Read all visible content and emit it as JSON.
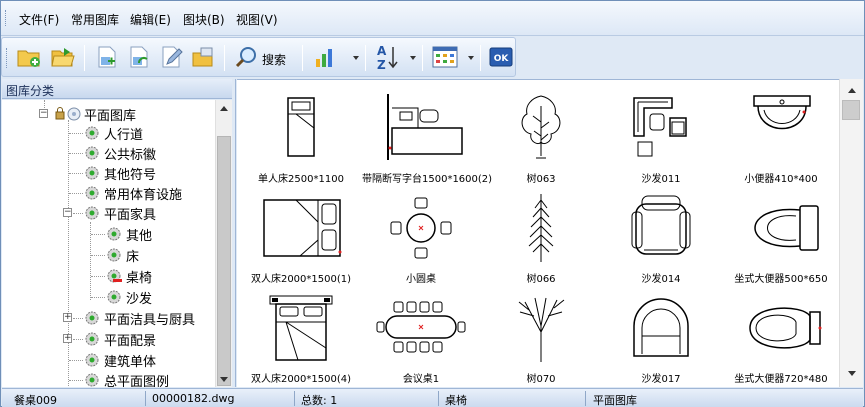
{
  "menu": {
    "items": [
      "文件(F)",
      "常用图库",
      "编辑(E)",
      "图块(B)",
      "视图(V)"
    ]
  },
  "toolbar": {
    "search_label": "搜索",
    "ok_label": "OK",
    "sort_label_top": "A",
    "sort_label_bottom": "Z"
  },
  "sidebar": {
    "header": "图库分类",
    "root": "平面图库",
    "items": [
      {
        "label": "人行道",
        "expander": ""
      },
      {
        "label": "公共标徽",
        "expander": ""
      },
      {
        "label": "其他符号",
        "expander": ""
      },
      {
        "label": "常用体育设施",
        "expander": ""
      },
      {
        "label": "平面家具",
        "expander": "−"
      },
      {
        "label": "其他",
        "expander": ""
      },
      {
        "label": "床",
        "expander": ""
      },
      {
        "label": "桌椅",
        "expander": ""
      },
      {
        "label": "沙发",
        "expander": ""
      },
      {
        "label": "平面洁具与厨具",
        "expander": "+"
      },
      {
        "label": "平面配景",
        "expander": "+"
      },
      {
        "label": "建筑单体",
        "expander": ""
      },
      {
        "label": "总平面图例",
        "expander": ""
      }
    ]
  },
  "grid": {
    "items": [
      {
        "caption": "单人床2500*1100",
        "icon": "single-bed-icon"
      },
      {
        "caption": "带隔断写字台1500*1600(2)",
        "icon": "partition-desk-icon"
      },
      {
        "caption": "树063",
        "icon": "tree-icon"
      },
      {
        "caption": "沙发011",
        "icon": "sofa-set-icon"
      },
      {
        "caption": "小便器410*400",
        "icon": "urinal-icon"
      },
      {
        "caption": "双人床2000*1500(1)",
        "icon": "double-bed-icon"
      },
      {
        "caption": "小圆桌",
        "icon": "round-table-icon"
      },
      {
        "caption": "树066",
        "icon": "conifer-tree-icon"
      },
      {
        "caption": "沙发014",
        "icon": "armchair-icon"
      },
      {
        "caption": "坐式大便器500*650",
        "icon": "toilet-icon"
      },
      {
        "caption": "双人床2000*1500(4)",
        "icon": "double-bed-icon"
      },
      {
        "caption": "会议桌1",
        "icon": "conference-table-icon"
      },
      {
        "caption": "树070",
        "icon": "branch-tree-icon"
      },
      {
        "caption": "沙发017",
        "icon": "round-armchair-icon"
      },
      {
        "caption": "坐式大便器720*480",
        "icon": "toilet-icon"
      }
    ]
  },
  "status": {
    "block_name": "餐桌009",
    "file": "00000182.dwg",
    "count_label": "总数: 1",
    "category": "桌椅",
    "library": "平面图库"
  },
  "colors": {
    "accent": "#6f8fb8",
    "toolbar_bg": "#d3e1f3",
    "marker_red": "#e02020"
  }
}
